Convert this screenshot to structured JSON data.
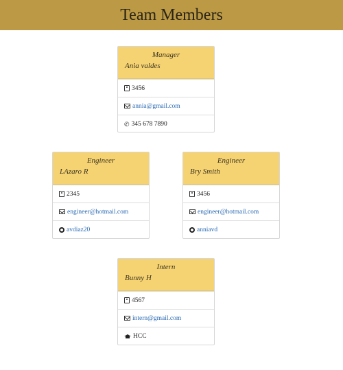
{
  "header": {
    "title": "Team Members"
  },
  "cards": [
    {
      "role": "Manager",
      "name": "Ania valdes",
      "id": "3456",
      "email": "annia@gmail.com",
      "extra": "345 678 7890",
      "extra_icon": "phone-icon"
    },
    {
      "role": "Engineer",
      "name": "LAzaro R",
      "id": "2345",
      "email": "engineer@hotmail.com",
      "extra": "avdiaz20",
      "extra_icon": "github-icon"
    },
    {
      "role": "Engineer",
      "name": "Bry Smith",
      "id": "3456",
      "email": "engineer@hotmail.com",
      "extra": "anniavd",
      "extra_icon": "github-icon"
    },
    {
      "role": "Intern",
      "name": "Bunny H",
      "id": "4567",
      "email": "intern@gmail.com",
      "extra": "HCC",
      "extra_icon": "graduation-cap-icon"
    }
  ],
  "colors": {
    "header_bg": "#bc9a45",
    "card_head_bg": "#f6d372",
    "link": "#2a6ab3"
  }
}
